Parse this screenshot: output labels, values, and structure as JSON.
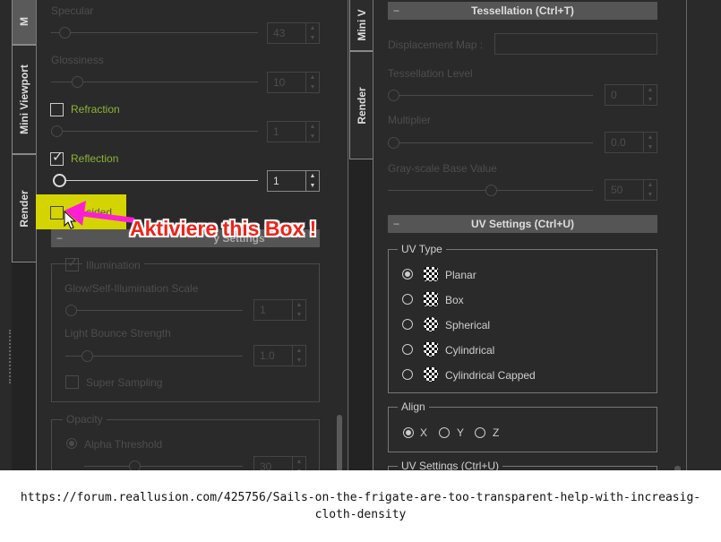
{
  "left_tabs": [
    "M",
    "Mini Viewport",
    "Render"
  ],
  "right_tabs": [
    "Mini V",
    "Render"
  ],
  "left": {
    "specular": {
      "label": "Specular",
      "value": "43"
    },
    "glossiness": {
      "label": "Glossiness",
      "value": "10"
    },
    "refraction": {
      "label": "Refraction",
      "checked": false,
      "value": "1"
    },
    "reflection": {
      "label": "Reflection",
      "checked": true,
      "value": "1"
    },
    "two_sided": {
      "label": "2 - sided",
      "checked": false
    },
    "section_header": "y Settings",
    "illumination": {
      "label": "Illumination",
      "checked": true,
      "glow_label": "Glow/Self-Illumination Scale",
      "glow_value": "1",
      "bounce_label": "Light Bounce Strength",
      "bounce_value": "1.0",
      "super_sampling": "Super Sampling"
    },
    "opacity": {
      "label": "Opacity",
      "alpha_threshold": "Alpha Threshold",
      "alpha_value": "30"
    }
  },
  "right": {
    "tessellation_header": "Tessellation  (Ctrl+T)",
    "displacement_label": "Displacement Map :",
    "tess_level": {
      "label": "Tessellation Level",
      "value": "0"
    },
    "multiplier": {
      "label": "Multiplier",
      "value": "0.0"
    },
    "grayscale": {
      "label": "Gray-scale Base Value",
      "value": "50"
    },
    "uv_header": "UV Settings  (Ctrl+U)",
    "uv_type": {
      "label": "UV Type",
      "options": [
        "Planar",
        "Box",
        "Spherical",
        "Cylindrical",
        "Cylindrical Capped"
      ],
      "selected": "Planar"
    },
    "align": {
      "label": "Align",
      "options": [
        "X",
        "Y",
        "Z"
      ],
      "selected": "X"
    },
    "uv_settings_group": "UV Settings  (Ctrl+U)"
  },
  "annotation": {
    "text": "Aktiviere this Box !",
    "highlight_color": "#d4d400",
    "arrow_color": "#ff1fd0",
    "text_color": "#e8261c"
  },
  "caption": "https://forum.reallusion.com/425756/Sails-on-the-frigate-are-too-transparent-help-with-increasig-cloth-density"
}
